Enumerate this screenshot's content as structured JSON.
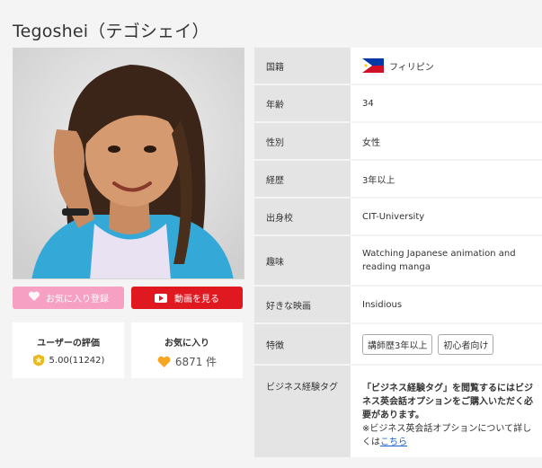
{
  "page": {
    "title": "Tegoshei（テゴシェイ）"
  },
  "actions": {
    "favorite_label": "お気に入り登録",
    "video_label": "動画を見る"
  },
  "stats": {
    "rating_label": "ユーザーの評価",
    "rating_value": "5.00(11242)",
    "favorites_label": "お気に入り",
    "favorites_value": "6871 件"
  },
  "profile": {
    "nationality": {
      "label": "国籍",
      "value": "フィリピン"
    },
    "age": {
      "label": "年齢",
      "value": "34"
    },
    "gender": {
      "label": "性別",
      "value": "女性"
    },
    "experience": {
      "label": "経歴",
      "value": "3年以上"
    },
    "school": {
      "label": "出身校",
      "value": "CIT-University"
    },
    "hobby": {
      "label": "趣味",
      "value": "Watching Japanese animation and reading manga"
    },
    "movie": {
      "label": "好きな映画",
      "value": "Insidious"
    },
    "features": {
      "label": "特徴",
      "tags": [
        "講師歴3年以上",
        "初心者向け"
      ]
    },
    "business_tag": {
      "label": "ビジネス経験タグ",
      "notice": "「ビジネス経験タグ」を閲覧するにはビジネス英会話オプションをご購入いただく必要があります。",
      "note": "※ビジネス英会話オプションについて詳しくは",
      "link_text": "こちら"
    }
  },
  "colors": {
    "favorite_button": "#f6a0c3",
    "video_button": "#e0181f",
    "label_bg": "#e4e4e4",
    "link": "#1a5fc9"
  },
  "icons": {
    "flag": "philippines-flag-icon",
    "rating": "star-badge-icon",
    "favorites": "heart-icon",
    "video": "youtube-play-icon"
  }
}
